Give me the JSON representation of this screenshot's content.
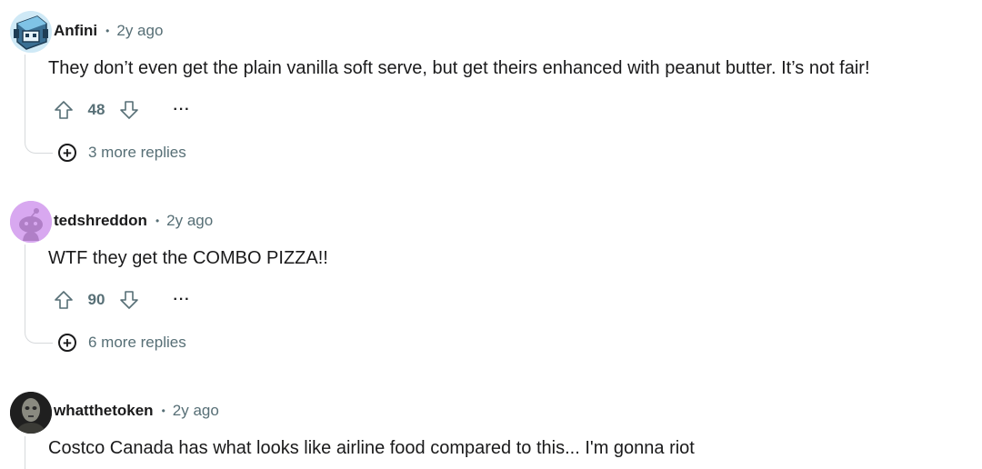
{
  "comments": [
    {
      "username": "Anfini",
      "separator": "•",
      "time": "2y ago",
      "body": "They don’t even get the plain vanilla soft serve, but get theirs enhanced with peanut butter. It’s not fair!",
      "score": "48",
      "more_label": "···",
      "replies_label": "3 more replies",
      "avatar_icon": "robot-avatar-icon"
    },
    {
      "username": "tedshreddon",
      "separator": "•",
      "time": "2y ago",
      "body": "WTF they get the COMBO PIZZA!!",
      "score": "90",
      "more_label": "···",
      "replies_label": "6 more replies",
      "avatar_icon": "snoo-avatar-icon"
    },
    {
      "username": "whatthetoken",
      "separator": "•",
      "time": "2y ago",
      "body": "Costco Canada has what looks like airline food compared to this... I'm gonna riot",
      "avatar_icon": "photo-avatar-icon"
    }
  ],
  "colors": {
    "text": "#1a1a1b",
    "meta": "#576f76",
    "thread_line": "#d7dadc",
    "avatar2_bg": "#d8a8f0"
  }
}
